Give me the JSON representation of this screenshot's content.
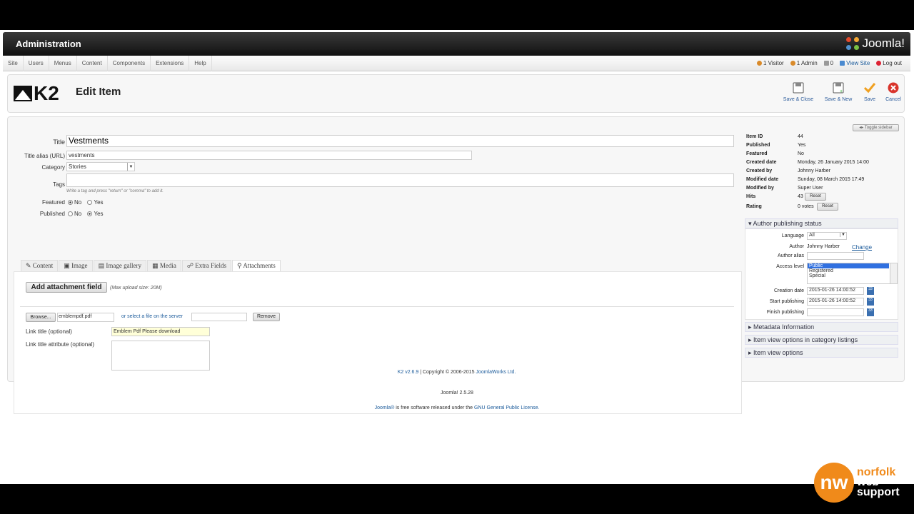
{
  "header": {
    "title": "Administration",
    "brand": "Joomla!"
  },
  "menu": [
    "Site",
    "Users",
    "Menus",
    "Content",
    "Components",
    "Extensions",
    "Help"
  ],
  "status": {
    "visitors": "1 Visitor",
    "admins": "1 Admin",
    "messages": "0",
    "view_site": "View Site",
    "logout": "Log out"
  },
  "toolbar": {
    "logo": "K2",
    "page_title": "Edit Item",
    "save_close": "Save & Close",
    "save_new": "Save & New",
    "save": "Save",
    "cancel": "Cancel"
  },
  "form": {
    "title_label": "Title",
    "title_value": "Vestments",
    "alias_label": "Title alias (URL)",
    "alias_value": "vestments",
    "category_label": "Category",
    "category_value": "Stories",
    "tags_label": "Tags",
    "tags_hint": "Write a tag and press \"return\" or \"comma\" to add it.",
    "featured_label": "Featured",
    "published_label": "Published",
    "no": "No",
    "yes": "Yes"
  },
  "tabs": [
    "Content",
    "Image",
    "Image gallery",
    "Media",
    "Extra Fields",
    "Attachments"
  ],
  "attachments": {
    "add_button": "Add attachment field",
    "max_size": "(Max upload size: 20M)",
    "browse": "Browse...",
    "file_name": "emblempdf.pdf",
    "select_server": "or select a file on the server",
    "remove": "Remove",
    "link_title_label": "Link title (optional)",
    "link_title_value": "Emblem Pdf Please download",
    "link_attr_label": "Link title attribute (optional)"
  },
  "sidebar": {
    "toggle": "Toggle sidebar",
    "meta": [
      {
        "k": "Item ID",
        "v": "44"
      },
      {
        "k": "Published",
        "v": "Yes"
      },
      {
        "k": "Featured",
        "v": "No"
      },
      {
        "k": "Created date",
        "v": "Monday, 26 January 2015 14:00"
      },
      {
        "k": "Created by",
        "v": "Johnny Harber"
      },
      {
        "k": "Modified date",
        "v": "Sunday, 08 March 2015 17:49"
      },
      {
        "k": "Modified by",
        "v": "Super User"
      },
      {
        "k": "Hits",
        "v": "43"
      },
      {
        "k": "Rating",
        "v": "0 votes"
      }
    ],
    "reset": "Reset",
    "author_status": "Author publishing status",
    "language_label": "Language",
    "language_value": "All",
    "author_label": "Author",
    "author_value": "Johnny Harber",
    "change": "Change",
    "author_alias_label": "Author alias",
    "access_label": "Access level",
    "access_options": [
      "Public",
      "Registered",
      "Special"
    ],
    "creation_label": "Creation date",
    "creation_value": "2015-01-26 14:00:52",
    "start_label": "Start publishing",
    "start_value": "2015-01-26 14:00:52",
    "finish_label": "Finish publishing",
    "metadata": "Metadata Information",
    "cat_options": "Item view options in category listings",
    "view_options": "Item view options"
  },
  "footer": {
    "k2": "K2 v2.6.9",
    "copyright": "| Copyright © 2006-2015",
    "jw": "JoomlaWorks Ltd.",
    "joomla_version": "Joomla! 2.5.28",
    "license_pre": "Joomla®",
    "license_mid": "is free software released under the",
    "license_link": "GNU General Public License."
  },
  "watermark": {
    "line1": "norfolk",
    "line2": "web",
    "line3": "support"
  }
}
